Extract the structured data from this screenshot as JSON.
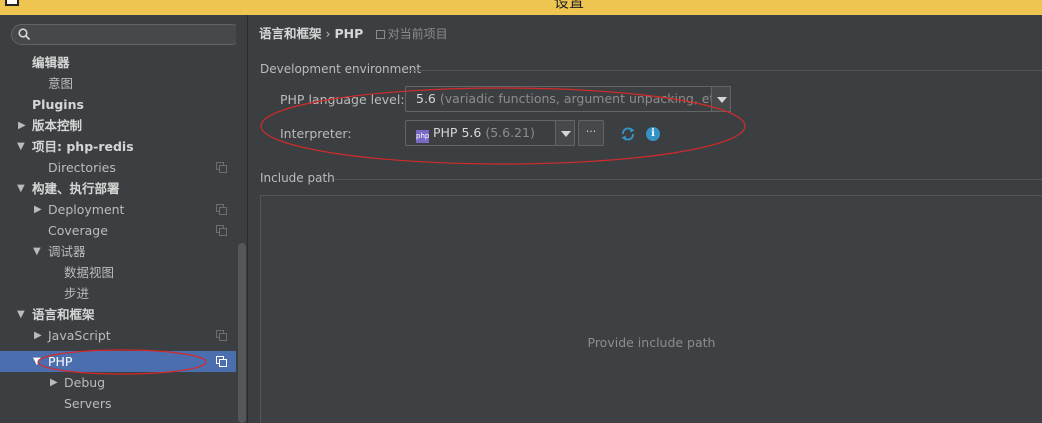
{
  "window": {
    "title": "设置"
  },
  "search": {
    "placeholder": ""
  },
  "sidebar": {
    "items": [
      {
        "label": "编辑器",
        "bold": true
      },
      {
        "label": "意图"
      },
      {
        "label": "Plugins",
        "bold": true
      },
      {
        "label": "版本控制",
        "bold": true
      },
      {
        "label": "项目: php-redis",
        "bold": true
      },
      {
        "label": "Directories"
      },
      {
        "label": "构建、执行部署",
        "bold": true
      },
      {
        "label": "Deployment"
      },
      {
        "label": "Coverage"
      },
      {
        "label": "调试器"
      },
      {
        "label": "数据视图"
      },
      {
        "label": "步进"
      },
      {
        "label": "语言和框架",
        "bold": true
      },
      {
        "label": "JavaScript"
      },
      {
        "label": "PHP",
        "selected": true
      },
      {
        "label": "Debug"
      },
      {
        "label": "Servers"
      }
    ]
  },
  "breadcrumb": {
    "parent": "语言和框架",
    "separator": "›",
    "current": "PHP",
    "scope": "对当前项目"
  },
  "dev_env": {
    "section_title": "Development environment",
    "language_level_label": "PHP language level:",
    "language_level_value": "5.6",
    "language_level_hint": "(variadic functions, argument unpacking, etc.)",
    "interpreter_label": "Interpreter:",
    "interpreter_badge": "php",
    "interpreter_value": "PHP 5.6",
    "interpreter_version": "(5.6.21)",
    "more_button": "···",
    "info_glyph": "i"
  },
  "include_path": {
    "section_title": "Include path",
    "empty_text": "Provide include path"
  },
  "colors": {
    "background": "#3c3f41",
    "selection": "#4b6eaf",
    "title_bar": "#efc552",
    "annotation": "#d42a2a",
    "info": "#3592c4"
  }
}
